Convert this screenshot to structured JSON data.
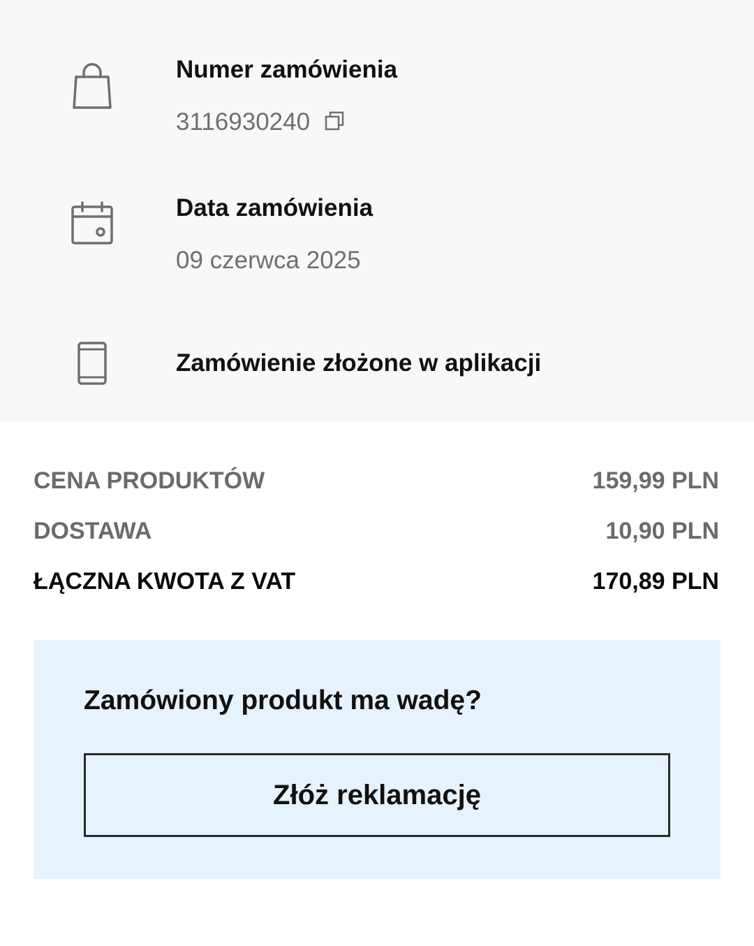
{
  "order_info": {
    "order_number": {
      "label": "Numer zamówienia",
      "value": "3116930240",
      "icon": "shopping-bag-icon",
      "action_icon": "copy-icon"
    },
    "order_date": {
      "label": "Data zamówienia",
      "value": "09 czerwca 2025",
      "icon": "calendar-icon"
    },
    "order_source": {
      "label": "Zamówienie złożone w aplikacji",
      "icon": "smartphone-icon"
    }
  },
  "summary": {
    "products": {
      "label": "CENA PRODUKTÓW",
      "value": "159,99 PLN"
    },
    "delivery": {
      "label": "DOSTAWA",
      "value": "10,90 PLN"
    },
    "total": {
      "label": "ŁĄCZNA KWOTA Z VAT",
      "value": "170,89 PLN"
    }
  },
  "claim": {
    "question": "Zamówiony produkt ma wadę?",
    "button_label": "Złóż reklamację"
  },
  "colors": {
    "info_panel_bg": "#f8f8f8",
    "claim_box_bg": "#e6f2fd",
    "muted_text": "#6b6b6b",
    "primary_text": "#111111"
  }
}
